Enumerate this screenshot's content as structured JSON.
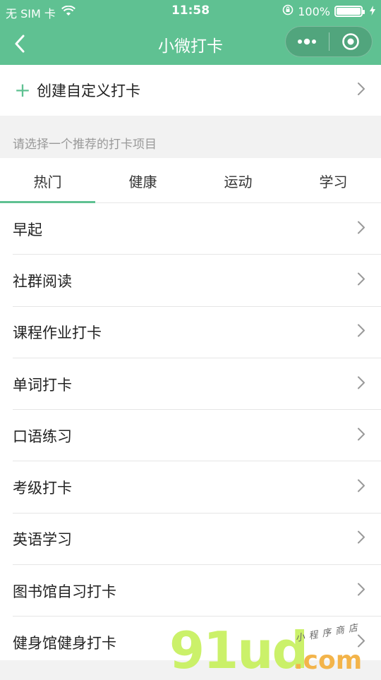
{
  "status_bar": {
    "carrier": "无 SIM 卡",
    "time": "11:58",
    "battery_pct": "100%"
  },
  "nav": {
    "title": "小微打卡"
  },
  "create": {
    "plus_glyph": "+",
    "label": "创建自定义打卡"
  },
  "hint": "请选择一个推荐的打卡项目",
  "tabs": [
    {
      "label": "热门",
      "active": true
    },
    {
      "label": "健康",
      "active": false
    },
    {
      "label": "运动",
      "active": false
    },
    {
      "label": "学习",
      "active": false
    }
  ],
  "items": [
    {
      "label": "早起"
    },
    {
      "label": "社群阅读"
    },
    {
      "label": "课程作业打卡"
    },
    {
      "label": "单词打卡"
    },
    {
      "label": "口语练习"
    },
    {
      "label": "考级打卡"
    },
    {
      "label": "英语学习"
    },
    {
      "label": "图书馆自习打卡"
    },
    {
      "label": "健身馆健身打卡"
    }
  ],
  "watermark": {
    "main": "91ud",
    "suffix": ".com",
    "small": "小程序商店"
  },
  "colors": {
    "accent": "#5fc192"
  }
}
